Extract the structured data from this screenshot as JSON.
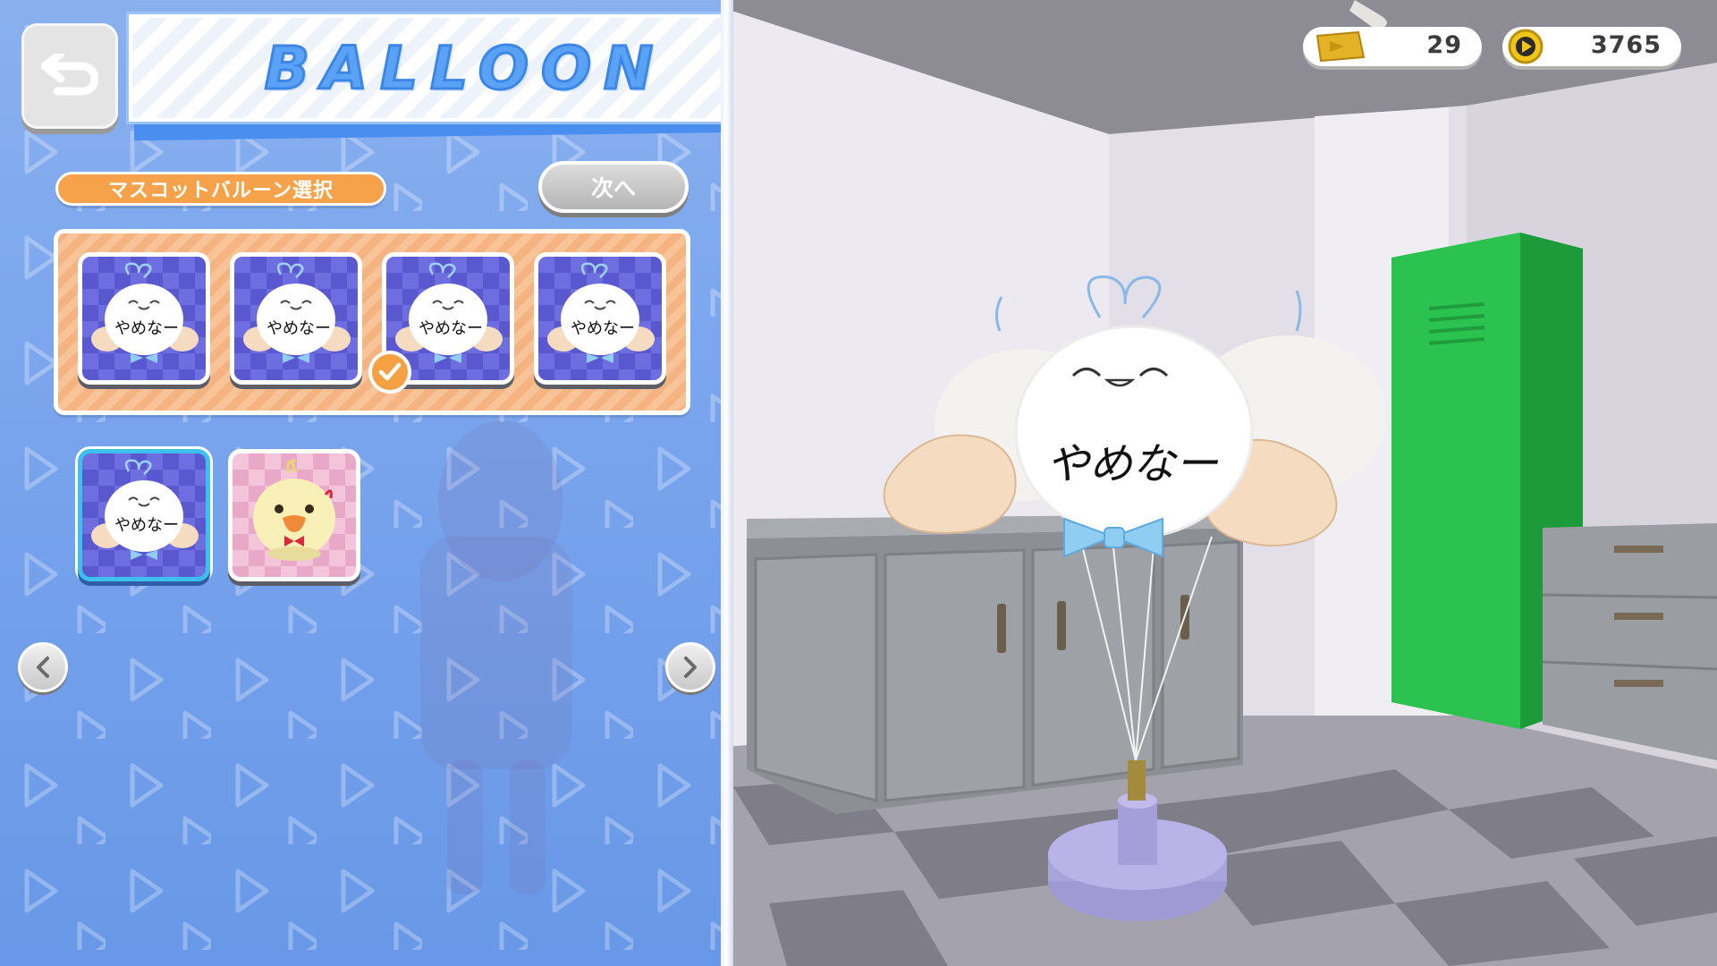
{
  "header": {
    "title": "BALLOON",
    "back_icon": "undo-arrow-icon"
  },
  "section": {
    "label": "マスコットバルーン選択",
    "next_label": "次へ"
  },
  "variants": {
    "selected_index": 2,
    "items": [
      {
        "icon": "yamenaa-balloon-icon",
        "text": "やめなー"
      },
      {
        "icon": "yamenaa-balloon-icon",
        "text": "やめなー"
      },
      {
        "icon": "yamenaa-balloon-icon",
        "text": "やめなー"
      },
      {
        "icon": "yamenaa-balloon-icon",
        "text": "やめなー"
      }
    ]
  },
  "mascots": {
    "selected_index": 0,
    "items": [
      {
        "icon": "yamenaa-balloon-icon",
        "text": "やめなー",
        "theme": "blue"
      },
      {
        "icon": "yellow-chick-balloon-icon",
        "text": "",
        "theme": "pink"
      }
    ]
  },
  "hud": {
    "tickets": {
      "icon": "gold-ticket-icon",
      "value": "29"
    },
    "coins": {
      "icon": "play-coin-icon",
      "value": "3765"
    }
  },
  "preview": {
    "balloon_text": "やめなー"
  },
  "colors": {
    "panel_blue": "#79a6ee",
    "accent_orange": "#f6a24a",
    "title_blue": "#5aa2f5",
    "selection_cyan": "#3ec0ee",
    "locker_green": "#2bc24f"
  }
}
